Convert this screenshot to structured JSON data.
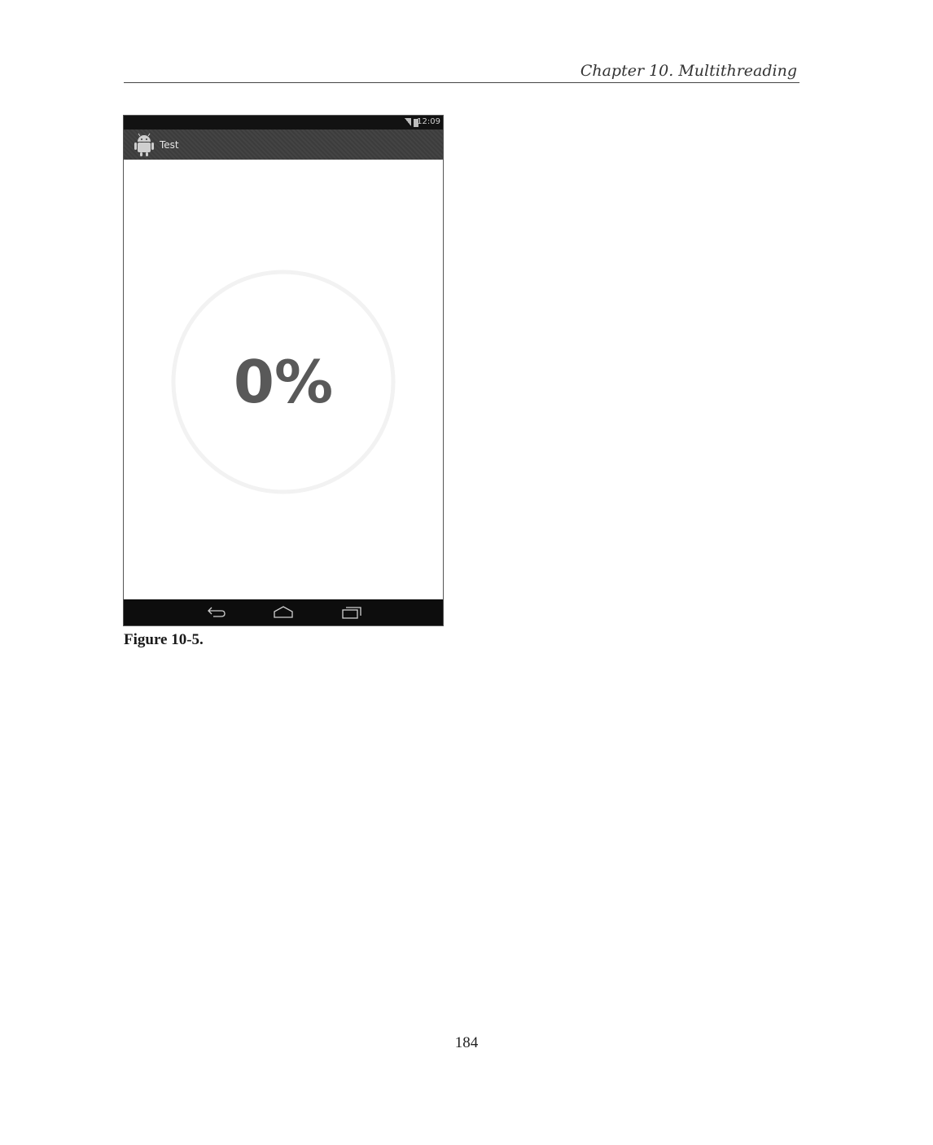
{
  "page": {
    "running_header": "Chapter 10. Multithreading",
    "figure_caption": "Figure 10-5.",
    "page_number": "184"
  },
  "screenshot": {
    "status_bar": {
      "time": "12:09",
      "icons": [
        "signal-icon",
        "battery-icon"
      ]
    },
    "action_bar": {
      "app_icon": "android-robot-icon",
      "title": "Test"
    },
    "progress": {
      "label": "0%",
      "fraction": 0.0
    },
    "nav_bar": {
      "buttons": [
        "back-icon",
        "home-icon",
        "recent-apps-icon"
      ]
    }
  }
}
